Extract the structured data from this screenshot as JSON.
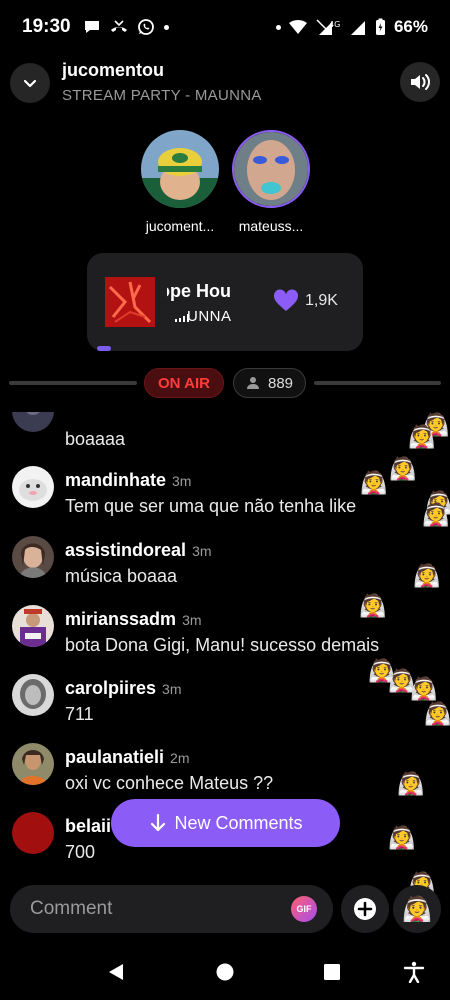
{
  "status_bar": {
    "time": "19:30",
    "network": "4G",
    "battery": "66%"
  },
  "header": {
    "title": "jucomentou",
    "subtitle": "STREAM PARTY - MAUNNA"
  },
  "hosts": [
    {
      "name": "jucoment..."
    },
    {
      "name": "mateuss..."
    }
  ],
  "now_playing": {
    "title": "ope    Hou",
    "artist": "UNNA",
    "likes": "1,9K"
  },
  "live": {
    "badge": "ON AIR",
    "viewers": "889"
  },
  "comments": [
    {
      "user": "",
      "time": "",
      "text": "boaaaa"
    },
    {
      "user": "mandinhate",
      "time": "3m",
      "text": "Tem que ser uma que não tenha like"
    },
    {
      "user": "assistindoreal",
      "time": "3m",
      "text": "música boaaa"
    },
    {
      "user": "mirianssadm",
      "time": "3m",
      "text": "bota Dona Gigi, Manu! sucesso demais"
    },
    {
      "user": "carolpiires",
      "time": "3m",
      "text": "711"
    },
    {
      "user": "paulanatieli",
      "time": "2m",
      "text": "oxi vc conhece Mateus ??"
    },
    {
      "user": "belaii",
      "time": "",
      "text": "700"
    }
  ],
  "new_comments_label": "New Comments",
  "composer": {
    "placeholder": "Comment",
    "gif_label": "GIF"
  },
  "reaction_emoji": "👰",
  "colors": {
    "accent": "#8b5cf6",
    "on_air": "#ff3b3b",
    "card_bg": "#1f1f22"
  }
}
